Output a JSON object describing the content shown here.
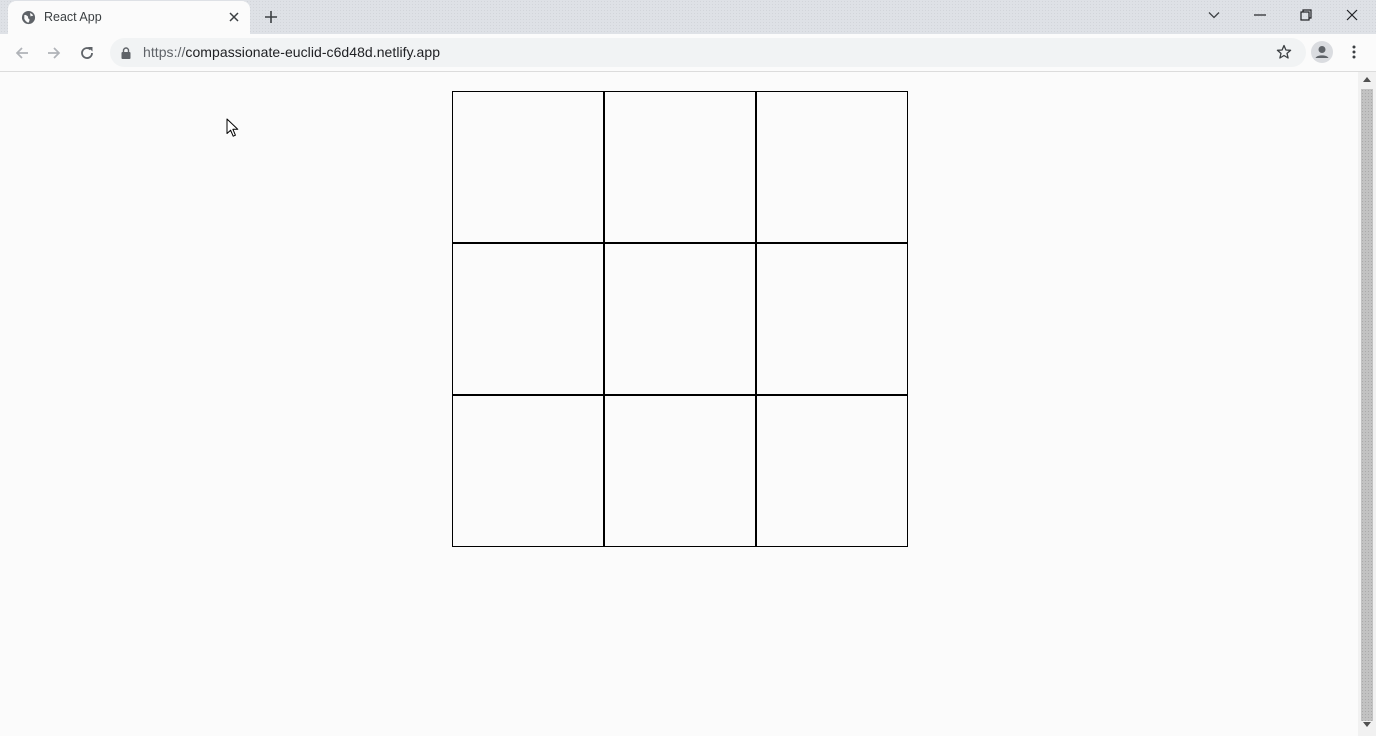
{
  "tab": {
    "title": "React App",
    "favicon": "globe-icon"
  },
  "address_bar": {
    "scheme": "https://",
    "host": "compassionate-euclid-c6d48d.netlify.app"
  },
  "board": {
    "squares": [
      "",
      "",
      "",
      "",
      "",
      "",
      "",
      "",
      ""
    ]
  },
  "colors": {
    "tab_strip": "#dee1e6",
    "page_background": "#fbfbfb",
    "board_border": "#000000"
  }
}
